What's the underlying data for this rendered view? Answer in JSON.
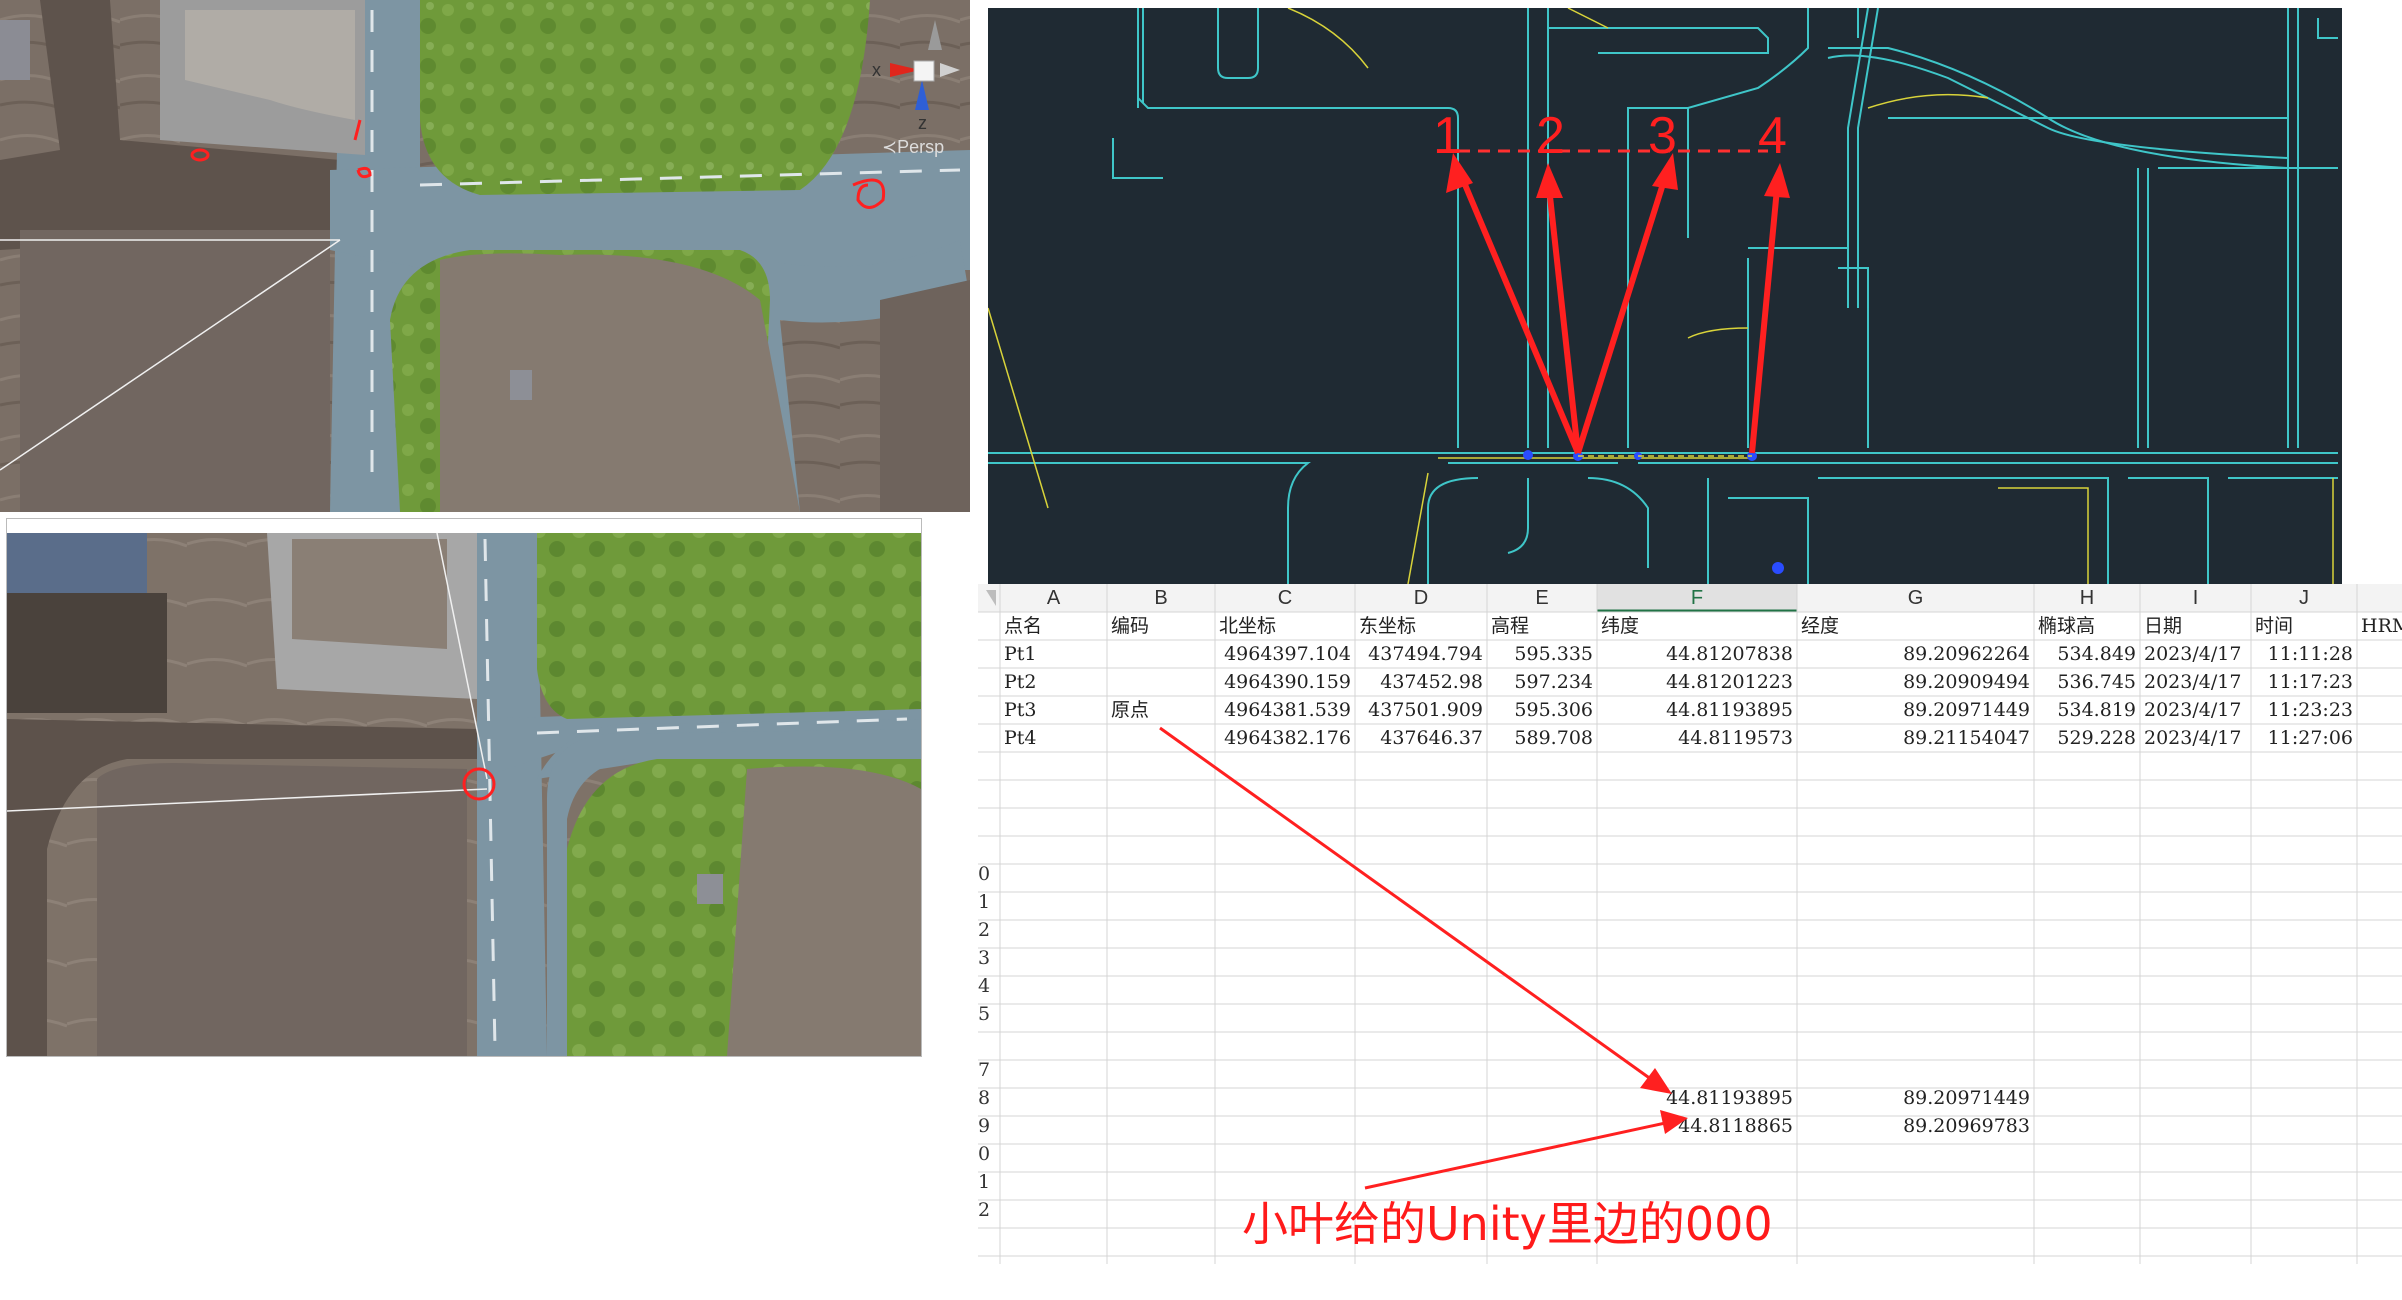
{
  "unity_top": {
    "gizmo": {
      "x_axis": "x",
      "z_axis": "z",
      "persp": "≺Persp"
    },
    "scribble_text": "1ρ"
  },
  "cad": {
    "markers": [
      "1",
      "2",
      "3",
      "4"
    ]
  },
  "sheet": {
    "columns": [
      "A",
      "B",
      "C",
      "D",
      "E",
      "F",
      "G",
      "H",
      "I",
      "J"
    ],
    "active_column": "F",
    "headers": [
      "点名",
      "编码",
      "北坐标",
      "东坐标",
      "高程",
      "纬度",
      "经度",
      "椭球高",
      "日期",
      "时间",
      "HRMS"
    ],
    "rows": [
      [
        "Pt1",
        "",
        "4964397.104",
        "437494.794",
        "595.335",
        "44.81207838",
        "89.20962264",
        "534.849",
        "2023/4/17",
        "11:11:28"
      ],
      [
        "Pt2",
        "",
        "4964390.159",
        "437452.98",
        "597.234",
        "44.81201223",
        "89.20909494",
        "536.745",
        "2023/4/17",
        "11:17:23"
      ],
      [
        "Pt3",
        "原点",
        "4964381.539",
        "437501.909",
        "595.306",
        "44.81193895",
        "89.20971449",
        "534.819",
        "2023/4/17",
        "11:23:23"
      ],
      [
        "Pt4",
        "",
        "4964382.176",
        "437646.37",
        "589.708",
        "44.8119573",
        "89.21154047",
        "529.228",
        "2023/4/17",
        "11:27:06"
      ]
    ],
    "row_numbers": [
      "0",
      "1",
      "2",
      "3",
      "4",
      "5",
      "",
      "7",
      "8",
      "9",
      "0",
      "1",
      "2"
    ],
    "extra_rows": [
      {
        "lat": "44.81193895",
        "lon": "89.20971449"
      },
      {
        "lat": "44.8118865",
        "lon": "89.20969783"
      }
    ]
  },
  "annotation": "小叶给的Unity里边的000",
  "colors": {
    "cad_bg": "#1f2a33",
    "cad_line": "#3fc6c9",
    "cad_yellow": "#d8d33a",
    "accent_red": "#ff2020",
    "grass": "#6e9a3a",
    "road": "#7d95a3",
    "dirt": "#7a6d62"
  }
}
